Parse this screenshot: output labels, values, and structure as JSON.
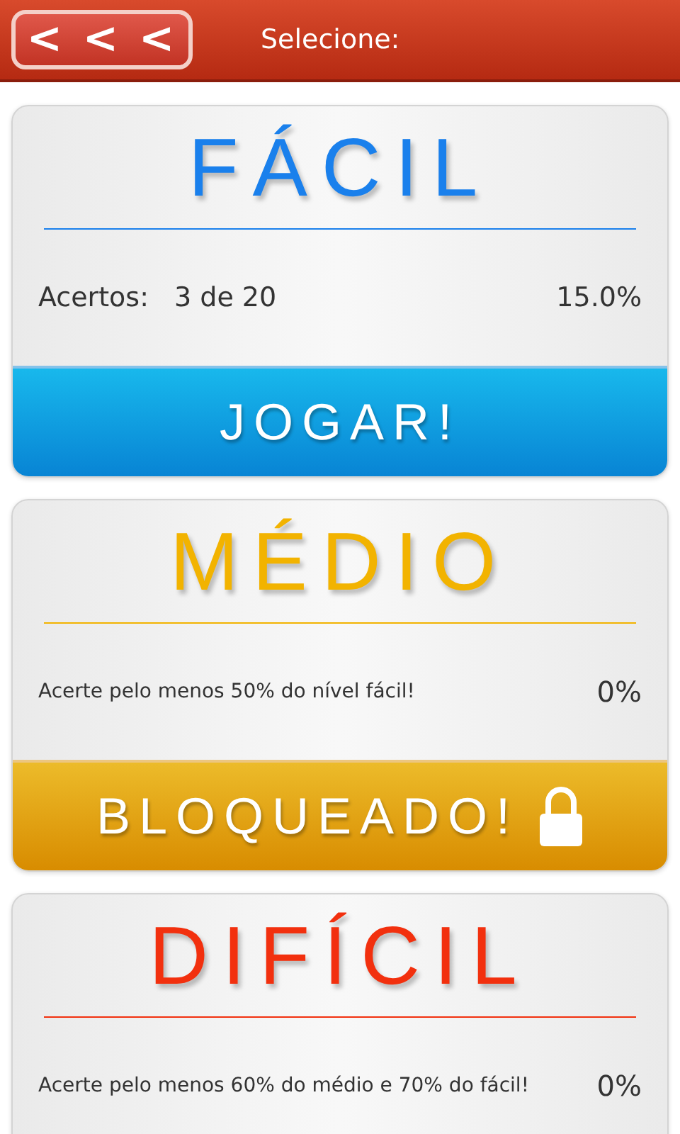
{
  "header": {
    "back_label": "< < <",
    "title": "Selecione:"
  },
  "levels": [
    {
      "kind": "score",
      "title": "FÁCIL",
      "color": "#1a80ec",
      "info_label": "Acertos:",
      "info_value": "3 de 20",
      "percent": "15.0%",
      "button": {
        "label": "JOGAR!",
        "locked": false
      }
    },
    {
      "kind": "requirement",
      "title": "MÉDIO",
      "color": "#f2b300",
      "info_value": "Acerte pelo menos 50% do nível fácil!",
      "percent": "0%",
      "button": {
        "label": "BLOQUEADO!",
        "locked": true
      }
    },
    {
      "kind": "requirement",
      "title": "DIFÍCIL",
      "color": "#f2300e",
      "info_value": "Acerte pelo menos 60% do médio e 70% do fácil!",
      "percent": "0%"
    }
  ]
}
